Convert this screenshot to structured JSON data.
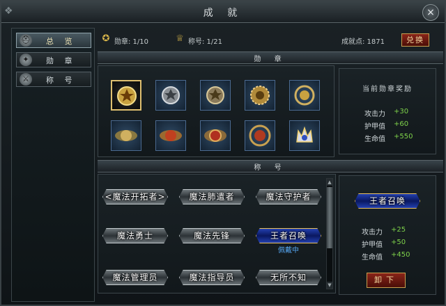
{
  "window": {
    "title": "成 就",
    "close_label": "×"
  },
  "sidebar": {
    "items": [
      {
        "label": "总 览",
        "icon": "helmet-icon",
        "active": true
      },
      {
        "label": "勋 章",
        "icon": "medal-icon",
        "active": false
      },
      {
        "label": "称 号",
        "icon": "wing-icon",
        "active": false
      }
    ]
  },
  "topbar": {
    "medals": "勋章: 1/10",
    "titles": "称号: 1/21",
    "points": "成就点: 1871",
    "redeem_label": "兑换"
  },
  "sections": {
    "medals": "勋 章",
    "titles": "称 号"
  },
  "medals": [
    {
      "name": "star-medal-icon",
      "selected": true
    },
    {
      "name": "silver-star-medal-icon"
    },
    {
      "name": "bronze-star-medal-icon"
    },
    {
      "name": "sun-medal-icon"
    },
    {
      "name": "wreath-medal-icon"
    },
    {
      "name": "winged-medal-icon"
    },
    {
      "name": "red-winged-medal-icon"
    },
    {
      "name": "crested-medal-icon"
    },
    {
      "name": "laurel-medal-icon"
    },
    {
      "name": "crown-medal-icon"
    }
  ],
  "medal_reward": {
    "title": "当前勋章奖励",
    "stats": [
      {
        "label": "攻击力",
        "value": "+30"
      },
      {
        "label": "护甲值",
        "value": "+60"
      },
      {
        "label": "生命值",
        "value": "+550"
      }
    ]
  },
  "titles": [
    {
      "text": "<魔法开拓者>",
      "style": "silver"
    },
    {
      "text": "魔法肺遣者",
      "style": "silver"
    },
    {
      "text": "魔法守护者",
      "style": "silver"
    },
    {
      "text": "魔法勇士",
      "style": "silver"
    },
    {
      "text": "魔法先锋",
      "style": "silver"
    },
    {
      "text": "王者召唤",
      "style": "gold",
      "wearing": "佩戴中"
    },
    {
      "text": "魔法管理员",
      "style": "silver"
    },
    {
      "text": "魔法指导员",
      "style": "silver"
    },
    {
      "text": "无所不知",
      "style": "silver"
    }
  ],
  "title_reward": {
    "current_title": "王者召唤",
    "stats": [
      {
        "label": "攻击力",
        "value": "+25"
      },
      {
        "label": "护甲值",
        "value": "+50"
      },
      {
        "label": "生命值",
        "value": "+450"
      }
    ],
    "unequip_label": "卸下"
  },
  "colors": {
    "accent_gold": "#e0c070",
    "stat_green": "#7ed24a",
    "wearing_blue": "#56a8f4"
  }
}
